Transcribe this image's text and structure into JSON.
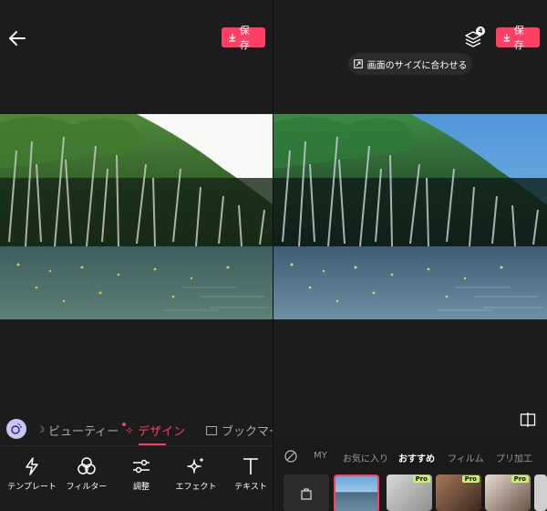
{
  "left": {
    "save_label": "保存",
    "tabs": [
      {
        "label": "ビューティー",
        "active": false
      },
      {
        "label": "デザイン",
        "active": true
      },
      {
        "label": "ブックマー",
        "active": false
      }
    ],
    "tools": [
      {
        "label": "テンプレート",
        "icon": "lightning-icon"
      },
      {
        "label": "フィルター",
        "icon": "circles-icon"
      },
      {
        "label": "調整",
        "icon": "sliders-icon"
      },
      {
        "label": "エフェクト",
        "icon": "sparkle-icon"
      },
      {
        "label": "テキスト",
        "icon": "text-t-icon"
      }
    ]
  },
  "right": {
    "save_label": "保存",
    "layers_badge": "4",
    "fit_label": "画面のサイズに合わせる",
    "categories": [
      "MY",
      "お気に入り",
      "おすすめ",
      "フィルム",
      "プリ加工"
    ],
    "active_category": "おすすめ",
    "pro_label": "Pro"
  },
  "colors": {
    "accent": "#ff3e63",
    "background": "#1c1c1c",
    "pro_badge": "#c6f36a"
  }
}
